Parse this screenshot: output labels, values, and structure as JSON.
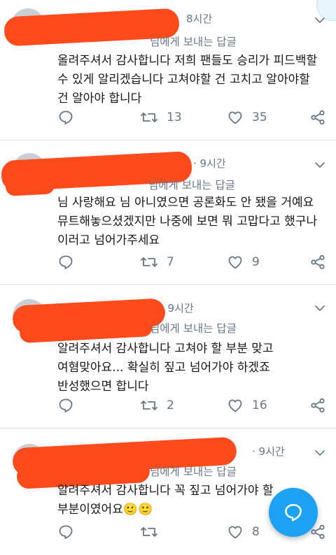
{
  "tweets": [
    {
      "time": "8시간",
      "reply_to": "님에게 보내는 답글",
      "text": "올려주셔서 감사합니다 저희 팬들도 승리가 피드백할 수 있게 알리겠습니다 고쳐야할 건 고치고 알아야할 건 알아야 합니다",
      "replies": "13",
      "likes": "35"
    },
    {
      "time": "· 9시간",
      "reply_to": "님에게 보내는 답글",
      "text": "님 사랑해요 님 아니였으면 공론화도 안 됐을 거예요 뮤트해놓으셨겠지만 나중에 보면 뭐 고맙다고 했구나 이러고 넘어가주세요",
      "replies": "7",
      "likes": "9"
    },
    {
      "time": "· 9시간",
      "reply_to": "님에게 보내는 답글",
      "text": "알려주셔서 감사합니다 고쳐야 할 부분 맞고 여혐맞아요... 확실히 짚고 넘어가야 하겠죠 반성했으면 합니다",
      "replies": "2",
      "likes": "16"
    },
    {
      "time": "· 9시간",
      "reply_to": "님에게 보내는 답글",
      "text": "알려주셔서 감사합니다 꼭 짚고 넘어가야 할 부분이였어요",
      "emoji": "🙂🙂",
      "replies": "",
      "likes": "8"
    }
  ],
  "icons": {
    "reply": "reply-icon",
    "retweet": "retweet-icon",
    "like": "heart-icon",
    "share": "share-icon",
    "more": "chevron-down-icon",
    "compose": "compose-reply-icon"
  },
  "colors": {
    "accent": "#1da1f2",
    "secondary_text": "#657786",
    "divider": "#e1e8ed",
    "redaction": "#ff4a1c"
  }
}
